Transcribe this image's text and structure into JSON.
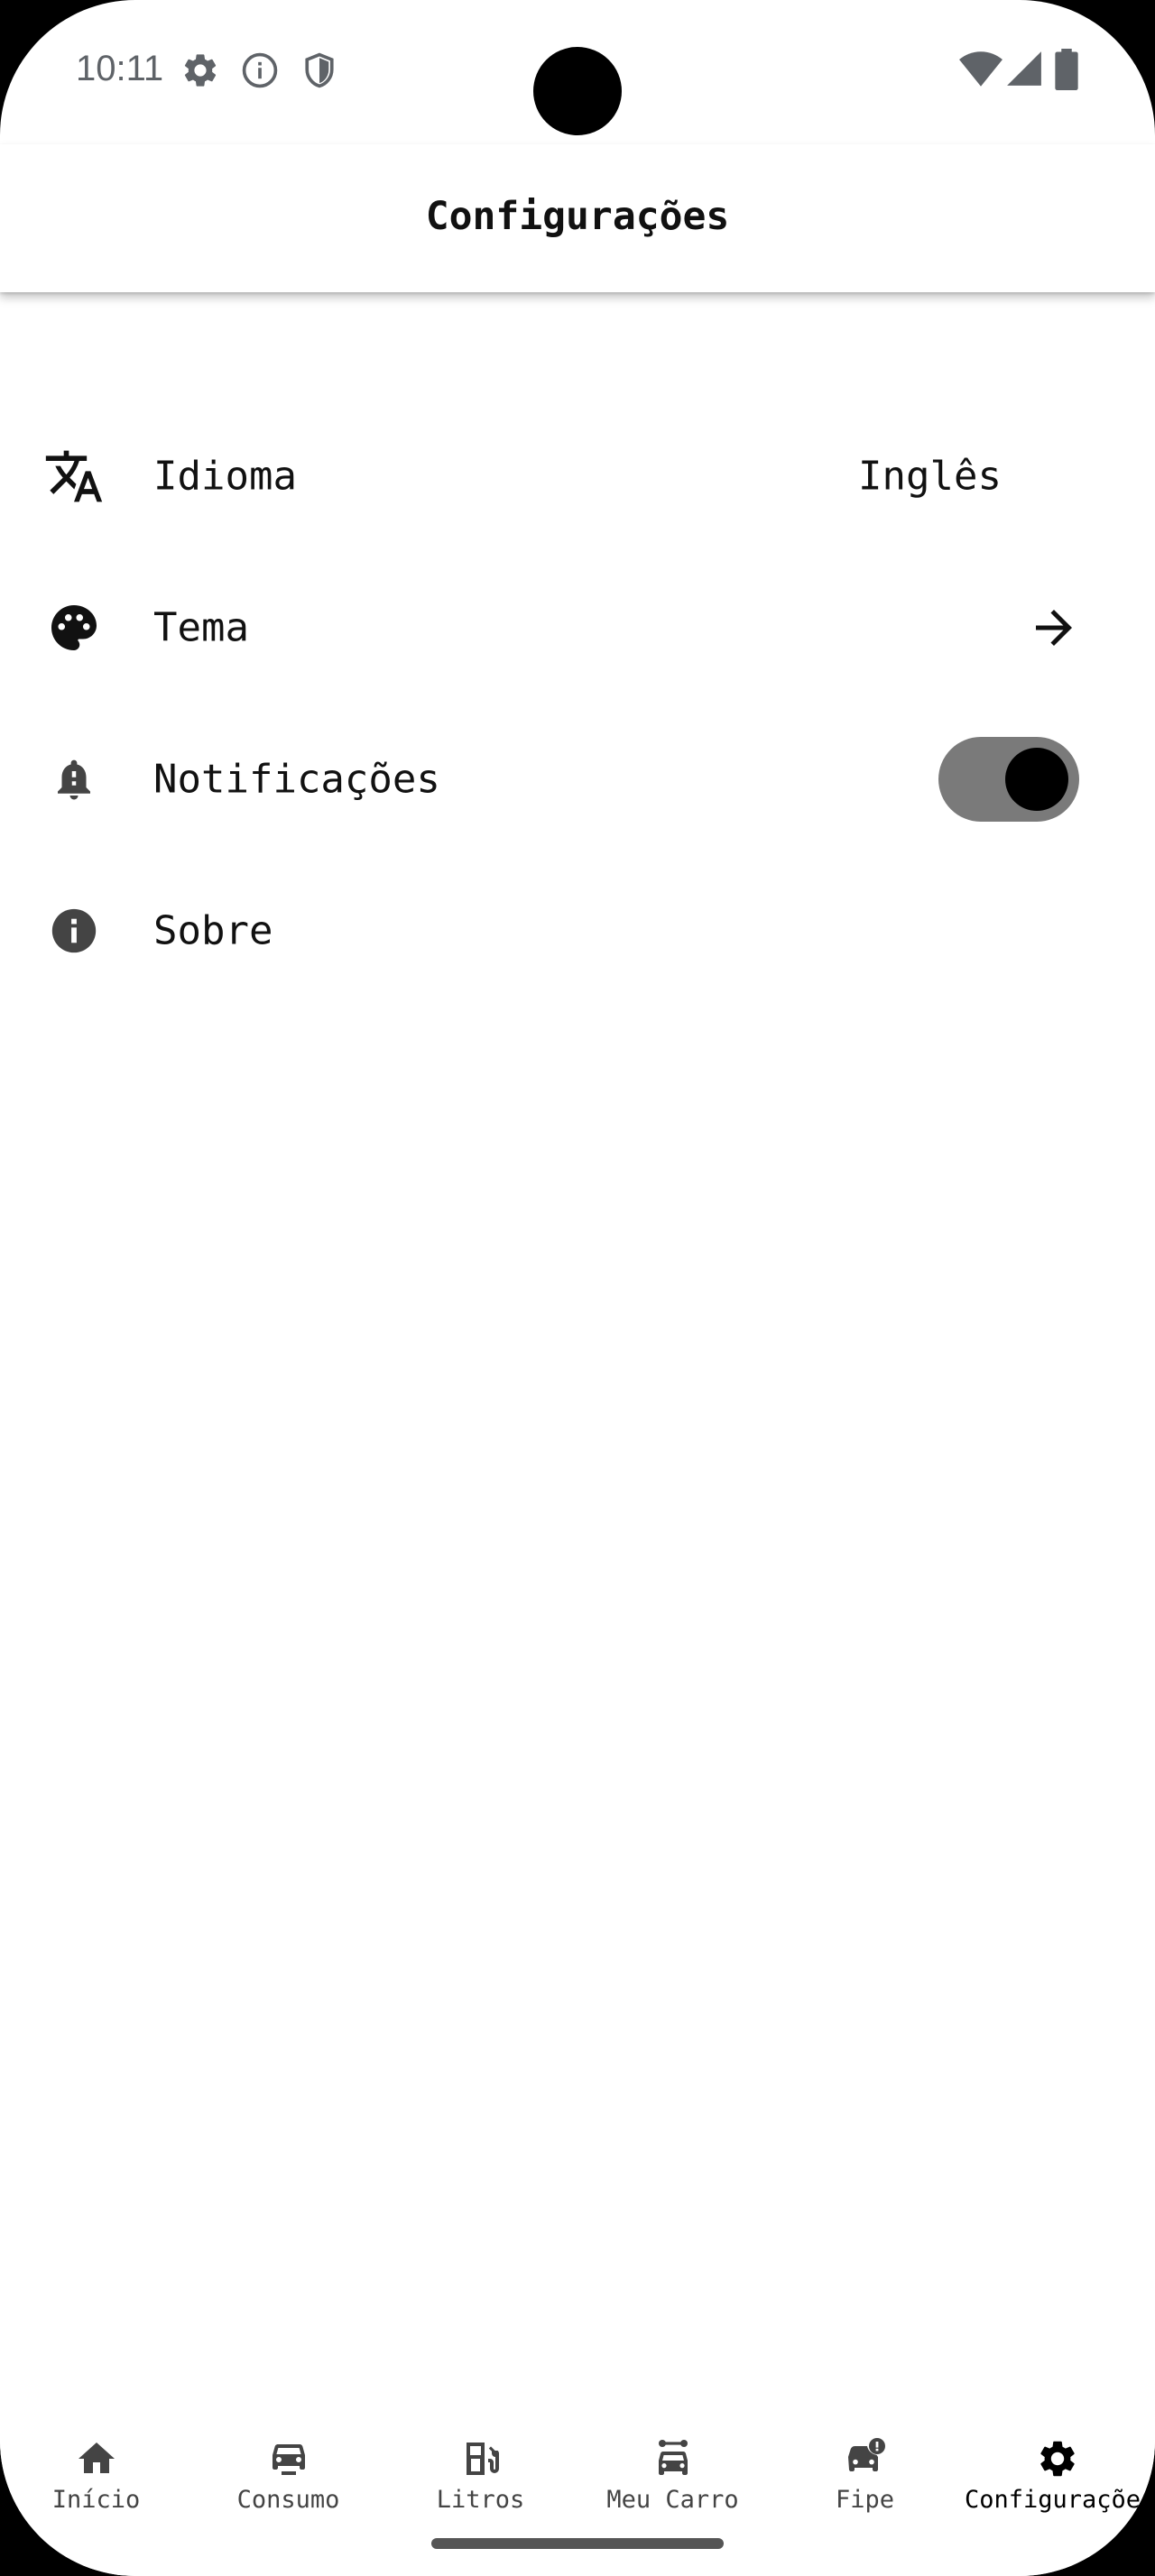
{
  "status_bar": {
    "time": "10:11",
    "left_icons": [
      "gear-icon",
      "info-icon",
      "shield-icon"
    ],
    "right_icons": [
      "wifi-icon",
      "signal-icon",
      "battery-icon"
    ]
  },
  "app_bar": {
    "title": "Configurações"
  },
  "settings": {
    "language": {
      "label": "Idioma",
      "value": "Inglês",
      "icon": "translate-icon"
    },
    "theme": {
      "label": "Tema",
      "icon": "palette-icon",
      "trailing": "arrow-right-icon"
    },
    "notifications": {
      "label": "Notificações",
      "icon": "bell-icon",
      "enabled": true
    },
    "about": {
      "label": "Sobre",
      "icon": "info-icon"
    }
  },
  "bottom_nav": {
    "items": [
      {
        "label": "Início",
        "icon": "home-icon",
        "active": false
      },
      {
        "label": "Consumo",
        "icon": "car-icon",
        "active": false
      },
      {
        "label": "Litros",
        "icon": "fuel-icon",
        "active": false
      },
      {
        "label": "Meu Carro",
        "icon": "car-route-icon",
        "active": false
      },
      {
        "label": "Fipe",
        "icon": "car-alert-icon",
        "active": false
      },
      {
        "label": "Configurações",
        "icon": "gear-icon",
        "active": true
      }
    ]
  },
  "colors": {
    "background": "#ffffff",
    "text": "#111111",
    "nav_inactive": "#444444",
    "toggle_track": "#7a7a7a",
    "toggle_thumb": "#000000"
  }
}
